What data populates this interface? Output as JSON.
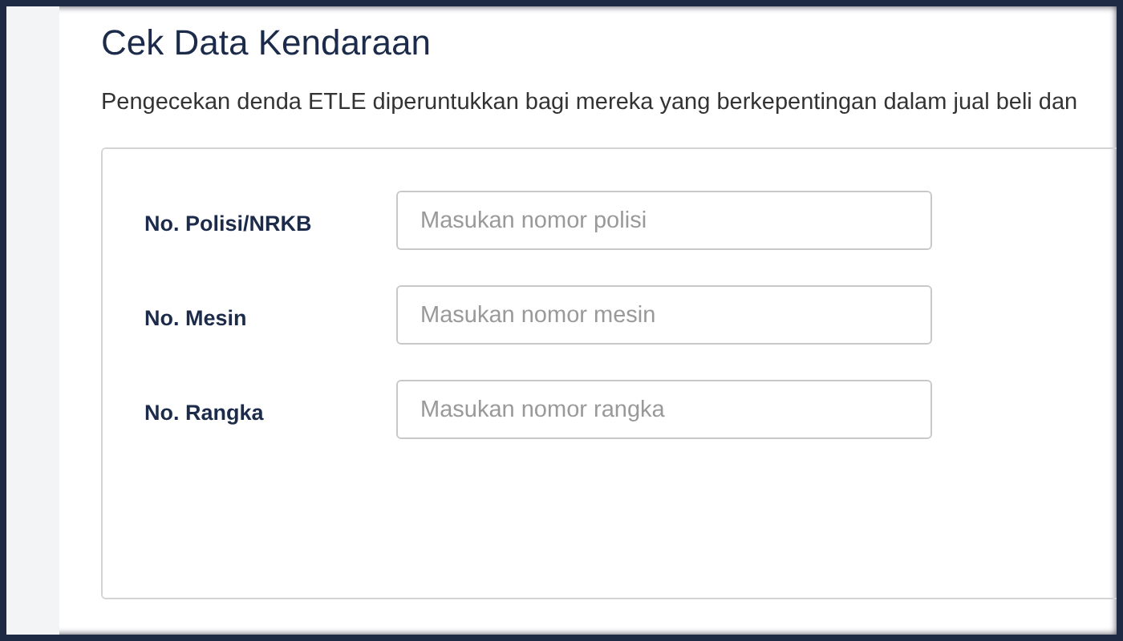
{
  "page": {
    "title": "Cek Data Kendaraan",
    "description": "Pengecekan denda ETLE diperuntukkan bagi mereka yang berkepentingan dalam jual beli dan"
  },
  "form": {
    "fields": [
      {
        "label": "No. Polisi/NRKB",
        "placeholder": "Masukan nomor polisi"
      },
      {
        "label": "No. Mesin",
        "placeholder": "Masukan nomor mesin"
      },
      {
        "label": "No. Rangka",
        "placeholder": "Masukan nomor rangka"
      }
    ]
  }
}
